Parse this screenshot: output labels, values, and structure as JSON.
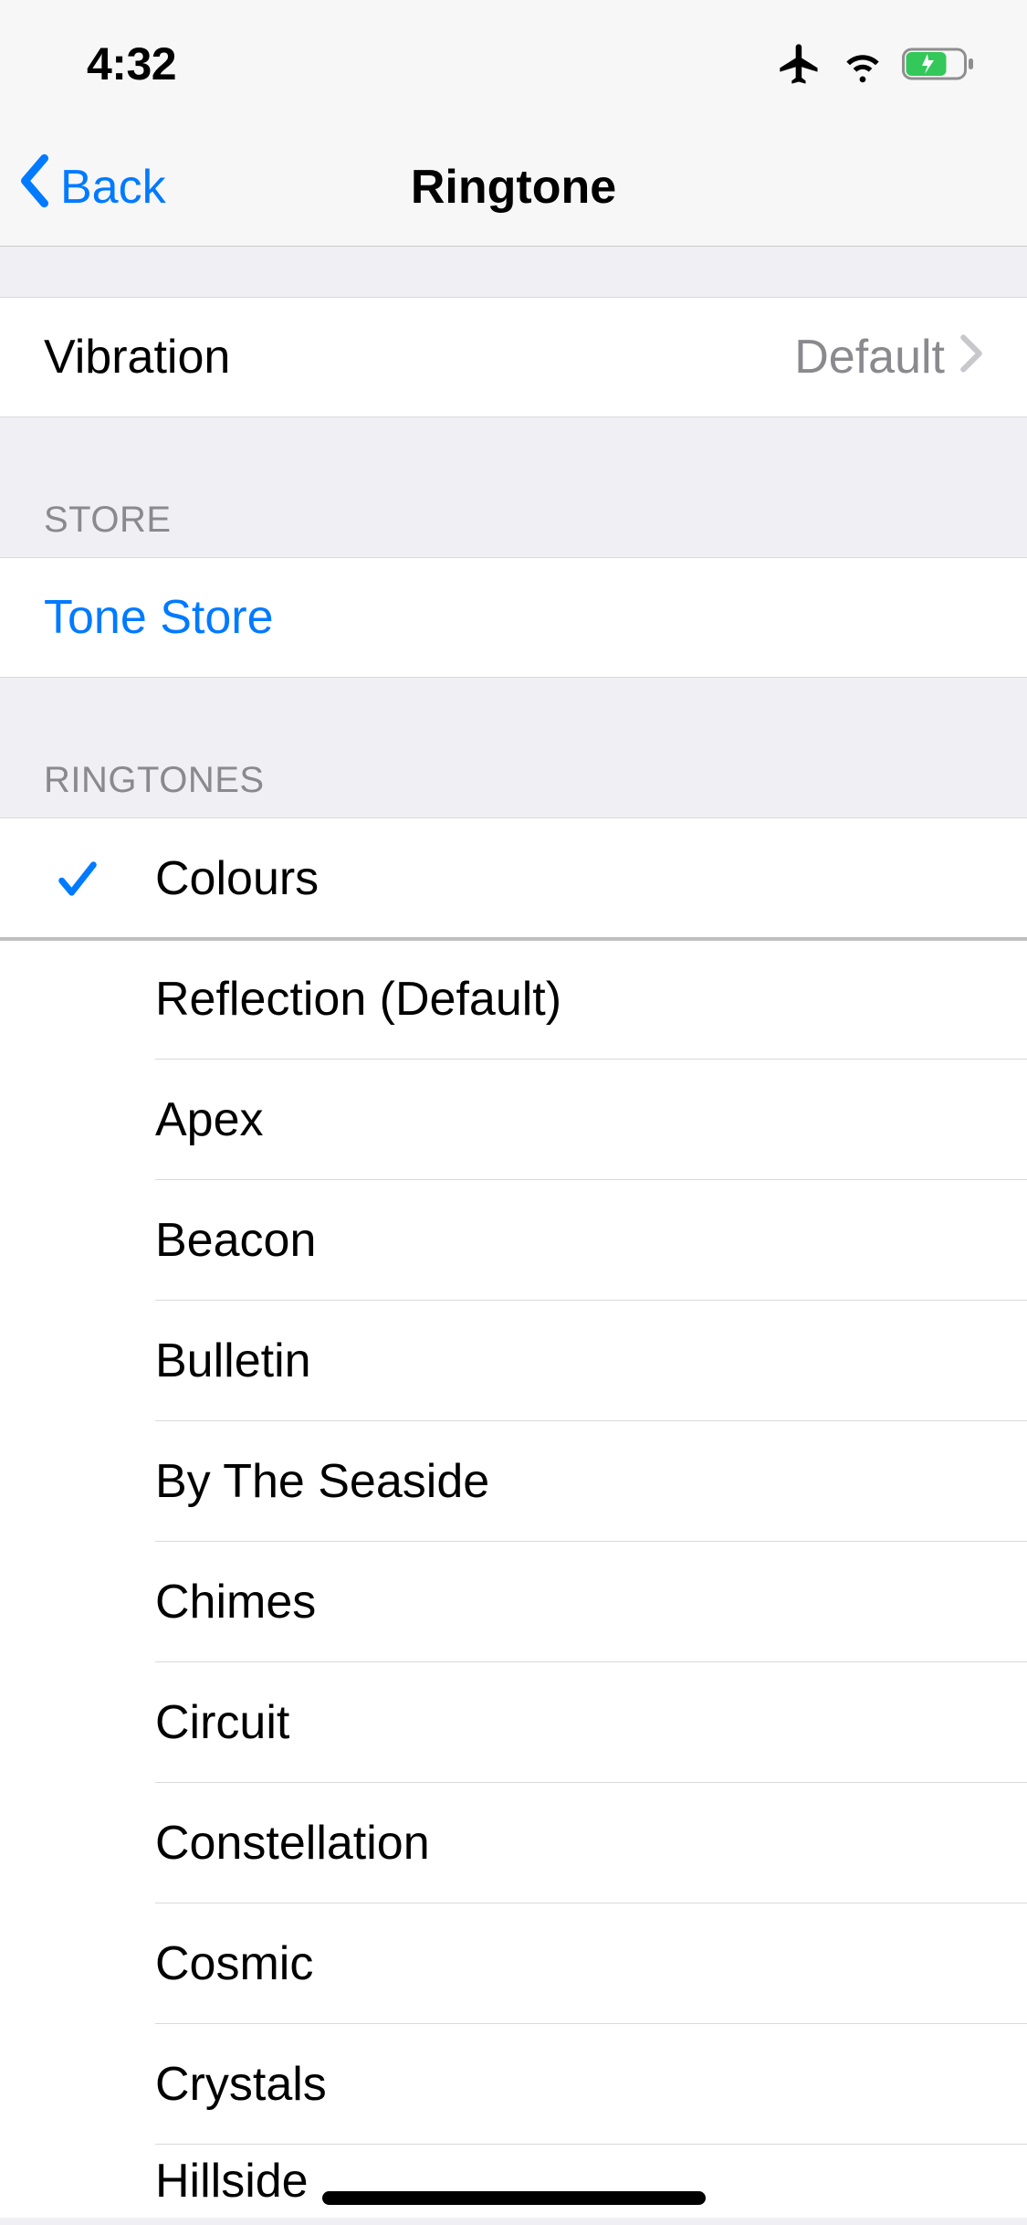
{
  "status": {
    "time": "4:32"
  },
  "nav": {
    "back_label": "Back",
    "title": "Ringtone"
  },
  "vibration": {
    "label": "Vibration",
    "value": "Default"
  },
  "store": {
    "header": "STORE",
    "tone_store": "Tone Store"
  },
  "ringtones": {
    "header": "RINGTONES",
    "selected_index": 0,
    "items": [
      "Colours",
      "Reflection (Default)",
      "Apex",
      "Beacon",
      "Bulletin",
      "By The Seaside",
      "Chimes",
      "Circuit",
      "Constellation",
      "Cosmic",
      "Crystals",
      "Hillside"
    ]
  }
}
